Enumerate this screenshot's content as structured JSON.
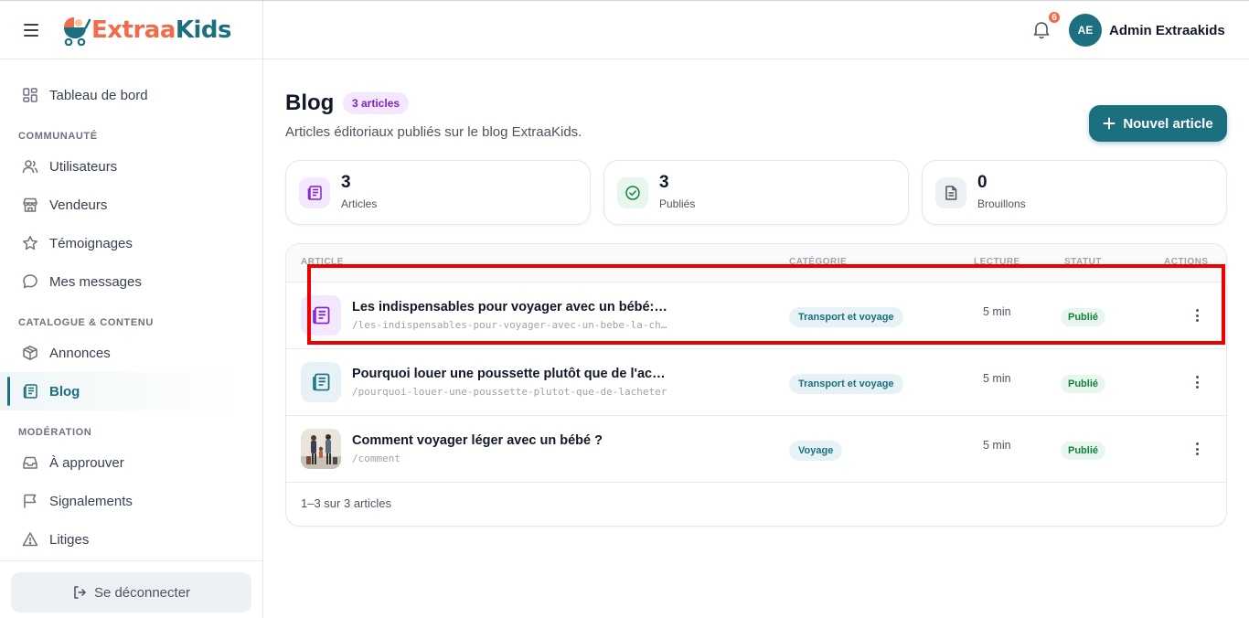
{
  "brand": {
    "part1": "Extraa",
    "part2": "Kids"
  },
  "sidebar": {
    "items": [
      {
        "label": "Tableau de bord",
        "icon": "dashboard-icon"
      },
      {
        "label": "Utilisateurs",
        "icon": "users-icon"
      },
      {
        "label": "Vendeurs",
        "icon": "store-icon"
      },
      {
        "label": "Témoignages",
        "icon": "star-icon"
      },
      {
        "label": "Mes messages",
        "icon": "chat-icon"
      },
      {
        "label": "Annonces",
        "icon": "box-icon"
      },
      {
        "label": "Blog",
        "icon": "newspaper-icon",
        "active": true
      },
      {
        "label": "À approuver",
        "icon": "inbox-icon"
      },
      {
        "label": "Signalements",
        "icon": "flag-icon"
      },
      {
        "label": "Litiges",
        "icon": "warning-icon"
      }
    ],
    "sections": [
      "COMMUNAUTÉ",
      "CATALOGUE & CONTENU",
      "MODÉRATION"
    ],
    "logout_label": "Se déconnecter"
  },
  "header": {
    "notifications_count": "6",
    "avatar_initials": "AE",
    "user_name": "Admin Extraakids"
  },
  "page": {
    "title": "Blog",
    "count_badge": "3 articles",
    "subtitle": "Articles éditoriaux publiés sur le blog ExtraaKids.",
    "new_button_label": "Nouvel article"
  },
  "stats": [
    {
      "value": "3",
      "label": "Articles",
      "color": "#7e22ce"
    },
    {
      "value": "3",
      "label": "Publiés",
      "color": "#15803d"
    },
    {
      "value": "0",
      "label": "Brouillons",
      "color": "#4b5563"
    }
  ],
  "table": {
    "columns": [
      "ARTICLE",
      "CATÉGORIE",
      "LECTURE",
      "STATUT",
      "ACTIONS"
    ],
    "rows": [
      {
        "title": "Les indispensables pour voyager avec un bébé: la checklist complète",
        "slug": "/les-indispensables-pour-voyager-avec-un-bebe-la-checklist",
        "category": "Transport et voyage",
        "reading": "5 min",
        "status": "Publié"
      },
      {
        "title": "Pourquoi louer une poussette plutôt que de l'acheter ?",
        "slug": "/pourquoi-louer-une-poussette-plutot-que-de-lacheter",
        "category": "Transport et voyage",
        "reading": "5 min",
        "status": "Publié"
      },
      {
        "title": "Comment voyager léger avec un bébé ?",
        "slug": "/comment",
        "category": "Voyage",
        "reading": "5 min",
        "status": "Publié"
      }
    ],
    "footer": "1–3 sur 3 articles"
  },
  "colors": {
    "primary": "#1c6f7f",
    "accent": "#f26b4a",
    "highlight": "#ee0000"
  }
}
